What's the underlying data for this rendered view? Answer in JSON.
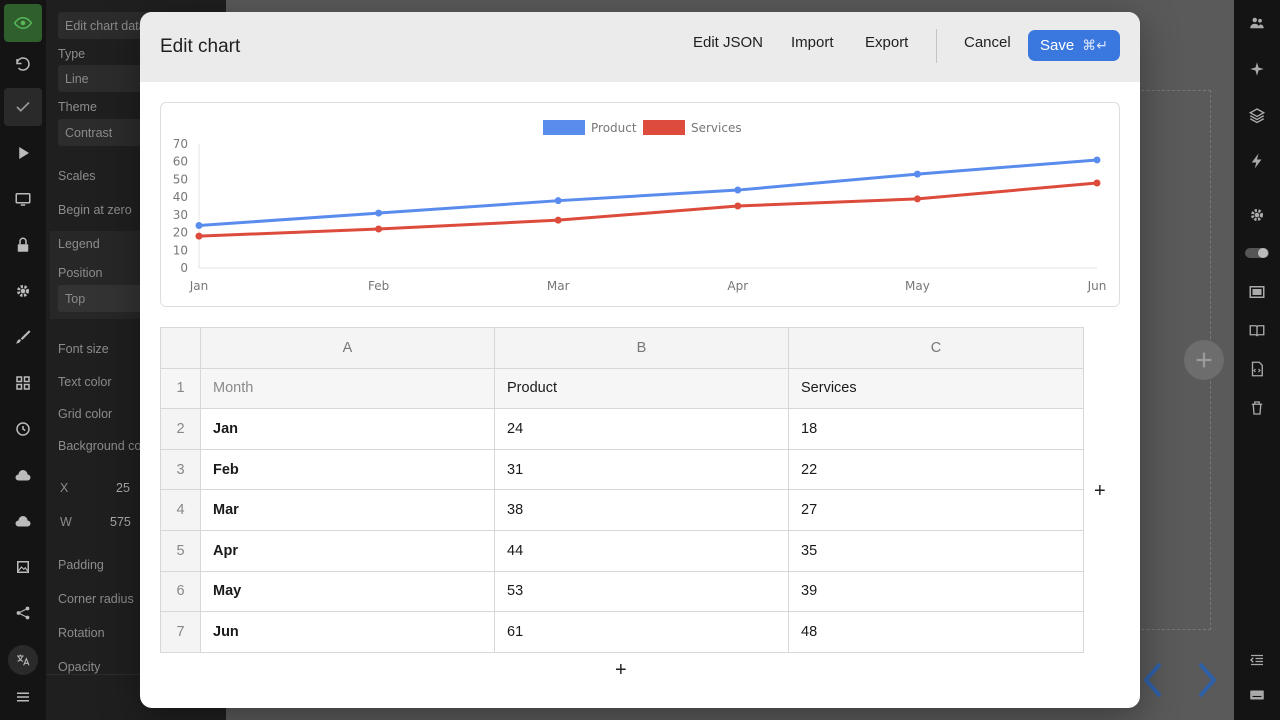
{
  "left_panel": {
    "edit_chart_data_label": "Edit chart data",
    "type_label": "Type",
    "type_value": "Line",
    "theme_label": "Theme",
    "theme_value": "Contrast",
    "scales_label": "Scales",
    "begin_at_zero_label": "Begin at zero",
    "legend_label": "Legend",
    "position_label": "Position",
    "position_value": "Top",
    "font_size_label": "Font size",
    "text_color_label": "Text color",
    "grid_color_label": "Grid color",
    "background_color_label": "Background co",
    "x_label": "X",
    "x_value": "25",
    "w_label": "W",
    "w_value": "575",
    "padding_label": "Padding",
    "corner_radius_label": "Corner radius",
    "rotation_label": "Rotation",
    "opacity_label": "Opacity"
  },
  "modal": {
    "title": "Edit chart",
    "edit_json_label": "Edit JSON",
    "import_label": "Import",
    "export_label": "Export",
    "cancel_label": "Cancel",
    "save_label": "Save",
    "save_shortcut": "⌘↵"
  },
  "sheet": {
    "column_headers": [
      "A",
      "B",
      "C"
    ],
    "rows": [
      [
        "1",
        "Month",
        "Product",
        "Services"
      ],
      [
        "2",
        "Jan",
        "24",
        "18"
      ],
      [
        "3",
        "Feb",
        "31",
        "22"
      ],
      [
        "4",
        "Mar",
        "38",
        "27"
      ],
      [
        "5",
        "Apr",
        "44",
        "35"
      ],
      [
        "6",
        "May",
        "53",
        "39"
      ],
      [
        "7",
        "Jun",
        "61",
        "48"
      ]
    ],
    "add_column_label": "+",
    "add_row_label": "+"
  },
  "colors": {
    "accent": "#3a78e0",
    "product_series": "#5a8cee",
    "services_series": "#dc4b3b"
  },
  "chart_data": {
    "type": "line",
    "categories": [
      "Jan",
      "Feb",
      "Mar",
      "Apr",
      "May",
      "Jun"
    ],
    "series": [
      {
        "name": "Product",
        "values": [
          24,
          31,
          38,
          44,
          53,
          61
        ],
        "color": "#5a8cee"
      },
      {
        "name": "Services",
        "values": [
          18,
          22,
          27,
          35,
          39,
          48
        ],
        "color": "#dc4b3b"
      }
    ],
    "yticks": [
      "0",
      "10",
      "20",
      "30",
      "40",
      "50",
      "60",
      "70"
    ],
    "ylim": [
      0,
      70
    ],
    "legend": "top-center",
    "grid": false
  }
}
